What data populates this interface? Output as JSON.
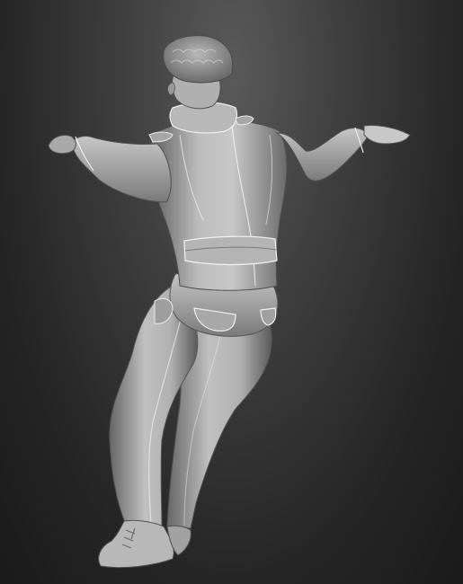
{
  "viewport": {
    "background_top": "#5a5a5a",
    "background_bottom": "#1a1a1a"
  },
  "model": {
    "material_light": "#d0d0d0",
    "material_mid": "#9a9a9a",
    "material_dark": "#4a4a4a",
    "parts": [
      "hat",
      "head",
      "collar",
      "jacket",
      "left-arm",
      "right-arm",
      "belt",
      "trousers",
      "left-boot",
      "right-boot"
    ]
  }
}
